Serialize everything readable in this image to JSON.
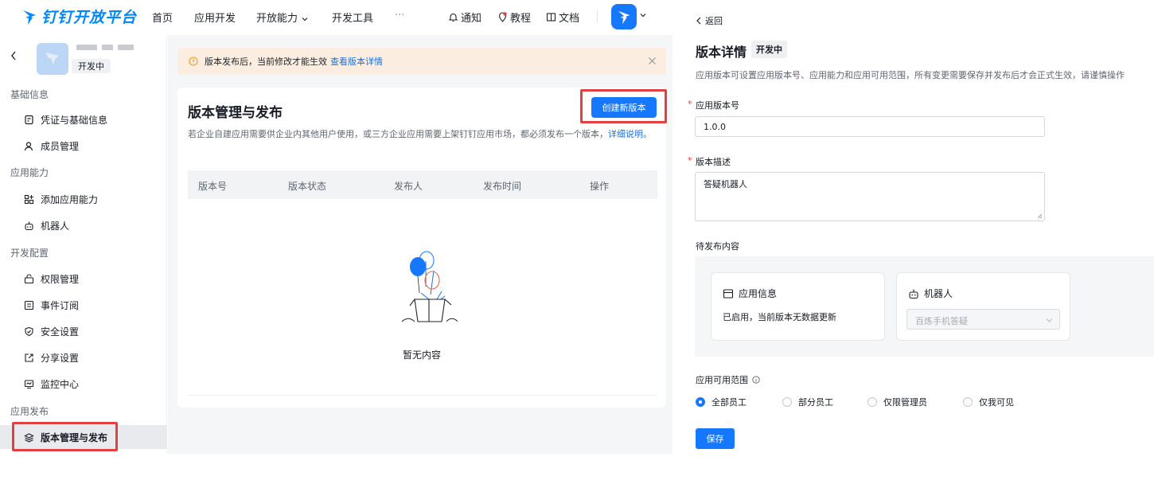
{
  "colors": {
    "brand": "#0089ff",
    "primary": "#1677ff",
    "highlight": "#e34141",
    "notice_bg": "#fbeee0"
  },
  "topbar": {
    "logo_text": "钉钉开放平台",
    "nav": [
      "首页",
      "应用开发",
      "开放能力",
      "开发工具",
      "···"
    ],
    "right": {
      "notify": "通知",
      "tutorial": "教程",
      "docs": "文档"
    }
  },
  "sidebar": {
    "app_status": "开发中",
    "sections": [
      {
        "title": "基础信息",
        "items": [
          {
            "label": "凭证与基础信息",
            "icon": "credential-icon"
          },
          {
            "label": "成员管理",
            "icon": "member-icon"
          }
        ]
      },
      {
        "title": "应用能力",
        "items": [
          {
            "label": "添加应用能力",
            "icon": "grid-add-icon"
          },
          {
            "label": "机器人",
            "icon": "robot-icon"
          }
        ]
      },
      {
        "title": "开发配置",
        "items": [
          {
            "label": "权限管理",
            "icon": "permission-icon"
          },
          {
            "label": "事件订阅",
            "icon": "event-icon"
          },
          {
            "label": "安全设置",
            "icon": "shield-icon"
          },
          {
            "label": "分享设置",
            "icon": "share-icon"
          },
          {
            "label": "监控中心",
            "icon": "monitor-icon"
          }
        ]
      },
      {
        "title": "应用发布",
        "items": [
          {
            "label": "版本管理与发布",
            "icon": "layers-icon"
          }
        ]
      }
    ]
  },
  "notice": {
    "text": "版本发布后，当前修改才能生效",
    "link": "查看版本详情"
  },
  "version_card": {
    "title": "版本管理与发布",
    "create_button": "创建新版本",
    "desc": "若企业自建应用需要供企业内其他用户使用，或三方企业应用需要上架钉钉应用市场，都必须发布一个版本，",
    "desc_link": "详细说明。",
    "columns": [
      "版本号",
      "版本状态",
      "发布人",
      "发布时间",
      "操作"
    ],
    "empty_text": "暂无内容"
  },
  "detail": {
    "back_label": "返回",
    "title": "版本详情",
    "status": "开发中",
    "desc": "应用版本可设置应用版本号、应用能力和应用可用范围，所有变更需要保存并发布后才会正式生效，请谨慎操作",
    "version_label": "应用版本号",
    "version_value": "1.0.0",
    "description_label": "版本描述",
    "description_value": "答疑机器人",
    "pending_label": "待发布内容",
    "app_info_card": {
      "title": "应用信息",
      "text": "已启用，当前版本无数据更新"
    },
    "robot_card": {
      "title": "机器人",
      "select_value": "百炼手机答疑"
    },
    "scope_label": "应用可用范围",
    "scope_options": [
      "全部员工",
      "部分员工",
      "仅限管理员",
      "仅我可见"
    ],
    "scope_selected": "全部员工",
    "save_button": "保存"
  }
}
